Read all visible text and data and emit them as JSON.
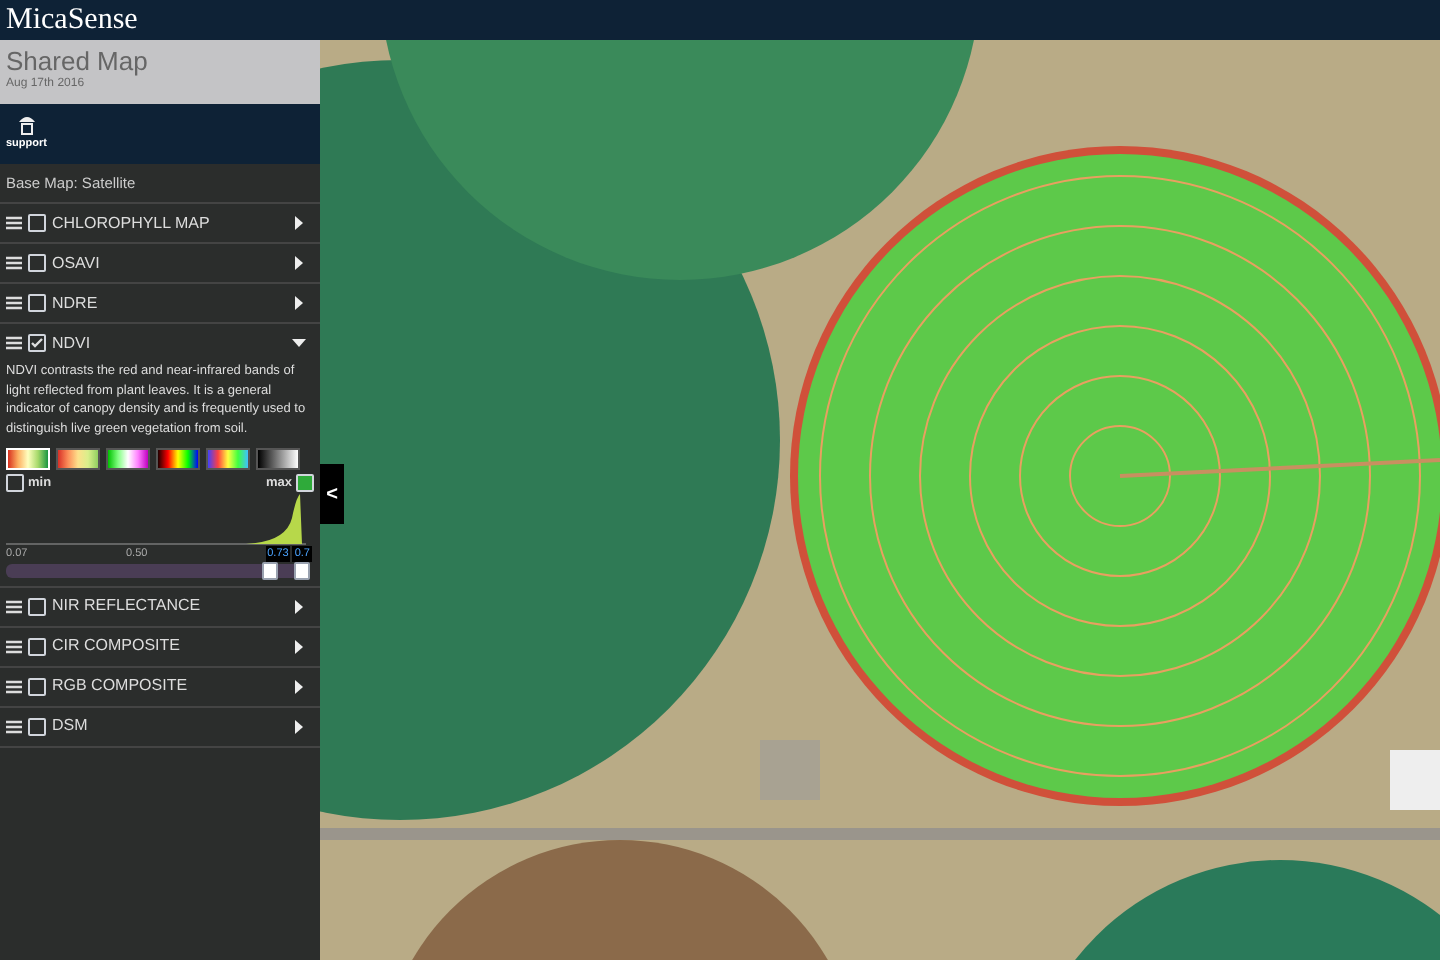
{
  "header": {
    "logo": "MicaSense"
  },
  "map_info": {
    "title": "Shared Map",
    "date": "Aug 17th 2016"
  },
  "support": {
    "label": "support"
  },
  "base_map": {
    "label": "Base Map: Satellite"
  },
  "layers": [
    {
      "name": "CHLOROPHYLL MAP",
      "checked": false,
      "expanded": false
    },
    {
      "name": "OSAVI",
      "checked": false,
      "expanded": false
    },
    {
      "name": "NDRE",
      "checked": false,
      "expanded": false
    },
    {
      "name": "NDVI",
      "checked": true,
      "expanded": true,
      "description": "NDVI contrasts the red and near-infrared bands of light reflected from plant leaves. It is a general indicator of canopy density and is frequently used to distinguish live green vegetation from soil.",
      "palettes": [
        {
          "selected": true
        },
        {
          "selected": false
        },
        {
          "selected": false
        },
        {
          "selected": false
        },
        {
          "selected": false
        },
        {
          "selected": false
        }
      ],
      "min": {
        "label": "min",
        "checked": false
      },
      "max": {
        "label": "max",
        "checked": true
      },
      "ticks": [
        "0.07",
        "0.50"
      ],
      "range_labels": [
        "0.73",
        "0.7"
      ],
      "thumbs": [
        {
          "level": 0.89
        },
        {
          "level": 1
        }
      ]
    },
    {
      "name": "NIR REFLECTANCE",
      "checked": false,
      "expanded": false
    },
    {
      "name": "CIR COMPOSITE",
      "checked": false,
      "expanded": false
    },
    {
      "name": "RGB COMPOSITE",
      "checked": false,
      "expanded": false
    },
    {
      "name": "DSM",
      "checked": false,
      "expanded": false
    }
  ],
  "collapse_button": {
    "label": "<"
  }
}
